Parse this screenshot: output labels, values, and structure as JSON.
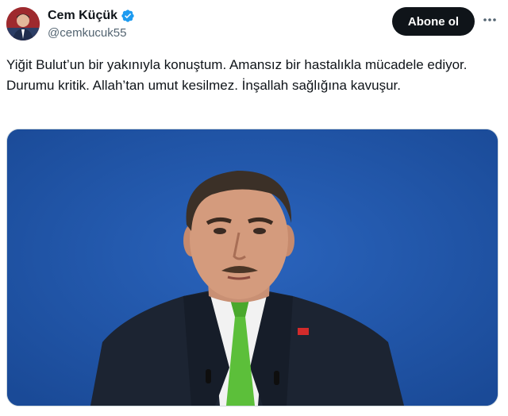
{
  "author": {
    "name": "Cem Küçük",
    "handle": "@cemkucuk55",
    "verified_icon": "verified-badge-icon",
    "avatar_bg": "#8a1f24"
  },
  "actions": {
    "follow_label": "Abone ol",
    "more_icon": "more-horizontal-icon"
  },
  "tweet": {
    "text": "Yiğit Bulut’un bir yakınıyla konuştum. Amansız bir hastalıkla mücadele ediyor. Durumu kritik. Allah’tan umut kesilmez. İnşallah sağlığına kavuşur."
  },
  "media": {
    "background_color": "#1f55a8",
    "tie_color": "#5cbf3a"
  }
}
